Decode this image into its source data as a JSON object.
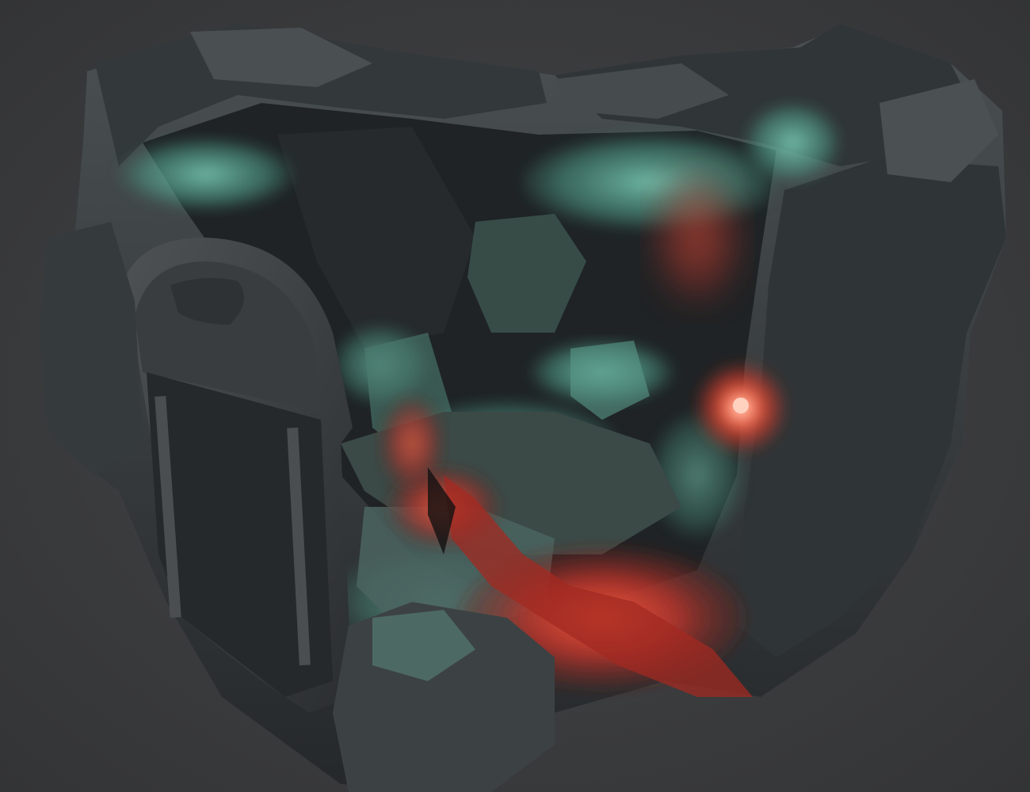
{
  "scene": {
    "subject": "cave-dungeon-diorama",
    "palette": {
      "background": "#3a3b3d",
      "rock_dark": "#2a2d2f",
      "rock_mid": "#3e4346",
      "rock_light": "#565c5e",
      "teal_glow": "#5fb8a2",
      "teal_bright": "#7fd6bf",
      "lava_red": "#b8332a",
      "lava_glow": "#ff5a3c",
      "fire_core": "#ff7a5a"
    },
    "elements": [
      {
        "name": "outer-rock-wall",
        "kind": "rock"
      },
      {
        "name": "stone-archway-door",
        "kind": "structure"
      },
      {
        "name": "cave-floor-platform",
        "kind": "terrain"
      },
      {
        "name": "lava-fissure",
        "kind": "hazard"
      },
      {
        "name": "glowing-torch",
        "kind": "light"
      },
      {
        "name": "crystal-rock-formations",
        "kind": "rock"
      }
    ]
  }
}
